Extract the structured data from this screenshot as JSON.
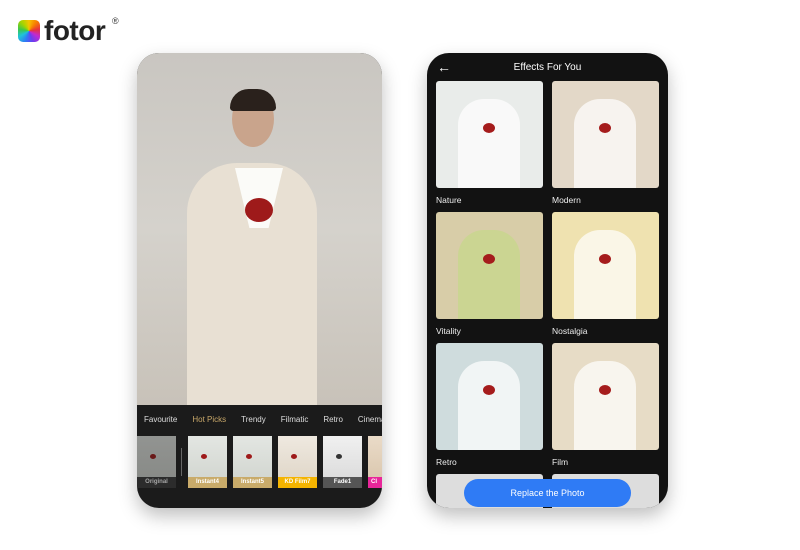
{
  "brand": {
    "name": "fotor",
    "registered": "®"
  },
  "editor": {
    "categories": [
      {
        "label": "Favourite",
        "active": false
      },
      {
        "label": "Hot Picks",
        "active": true
      },
      {
        "label": "Trendy",
        "active": false
      },
      {
        "label": "Filmatic",
        "active": false
      },
      {
        "label": "Retro",
        "active": false
      },
      {
        "label": "Cinemat",
        "active": false
      }
    ],
    "filters": [
      {
        "label": "Original",
        "color": "#3a3a3a"
      },
      {
        "label": "Instant4",
        "color": "#c9ab6a"
      },
      {
        "label": "Instant5",
        "color": "#c9ab6a"
      },
      {
        "label": "KD Film7",
        "color": "#f5b400"
      },
      {
        "label": "Fade1",
        "color": "#555555"
      },
      {
        "label": "Cl",
        "color": "#e8269a"
      }
    ]
  },
  "effects": {
    "title": "Effects For You",
    "back_icon": "arrow-left-icon",
    "items": [
      {
        "label": "Nature",
        "tint": "#e9ecea"
      },
      {
        "label": "Modern",
        "tint": "#e3d8c8"
      },
      {
        "label": "Vitality",
        "tint": "#d8cda8"
      },
      {
        "label": "Nostalgia",
        "tint": "#efe2b0"
      },
      {
        "label": "Retro",
        "tint": "#cfdcdd"
      },
      {
        "label": "Film",
        "tint": "#e7dcc6"
      }
    ],
    "replace_button": "Replace the Photo",
    "accent": "#2f7bf5"
  }
}
